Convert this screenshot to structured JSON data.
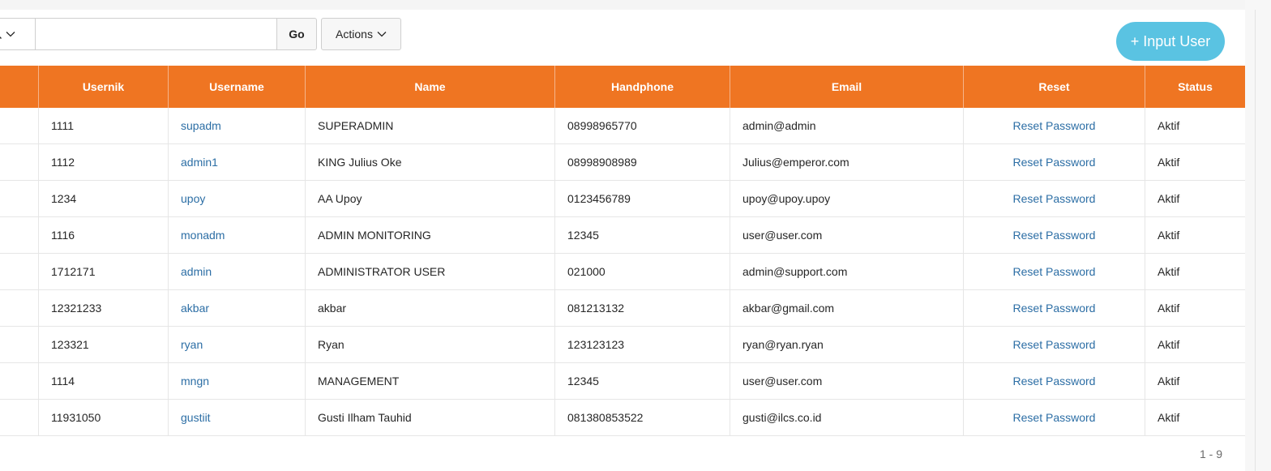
{
  "toolbar": {
    "search_icon": "search-icon",
    "search_placeholder": "",
    "search_value": "",
    "go_label": "Go",
    "actions_label": "Actions",
    "input_user_label": "+ Input User"
  },
  "table": {
    "columns": [
      "",
      "Usernik",
      "Username",
      "Name",
      "Handphone",
      "Email",
      "Reset",
      "Status"
    ],
    "rows": [
      {
        "usernik": "1111",
        "username": "supadm",
        "name": "SUPERADMIN",
        "handphone": "08998965770",
        "email": "admin@admin",
        "reset": "Reset Password",
        "status": "Aktif"
      },
      {
        "usernik": "1112",
        "username": "admin1",
        "name": "KING Julius Oke",
        "handphone": "08998908989",
        "email": "Julius@emperor.com",
        "reset": "Reset Password",
        "status": "Aktif"
      },
      {
        "usernik": "1234",
        "username": "upoy",
        "name": "AA Upoy",
        "handphone": "0123456789",
        "email": "upoy@upoy.upoy",
        "reset": "Reset Password",
        "status": "Aktif"
      },
      {
        "usernik": "1116",
        "username": "monadm",
        "name": "ADMIN MONITORING",
        "handphone": "12345",
        "email": "user@user.com",
        "reset": "Reset Password",
        "status": "Aktif"
      },
      {
        "usernik": "1712171",
        "username": "admin",
        "name": "ADMINISTRATOR USER",
        "handphone": "021000",
        "email": "admin@support.com",
        "reset": "Reset Password",
        "status": "Aktif"
      },
      {
        "usernik": "12321233",
        "username": "akbar",
        "name": "akbar",
        "handphone": "081213132",
        "email": "akbar@gmail.com",
        "reset": "Reset Password",
        "status": "Aktif"
      },
      {
        "usernik": "123321",
        "username": "ryan",
        "name": "Ryan",
        "handphone": "123123123",
        "email": "ryan@ryan.ryan",
        "reset": "Reset Password",
        "status": "Aktif"
      },
      {
        "usernik": "1114",
        "username": "mngn",
        "name": "MANAGEMENT",
        "handphone": "12345",
        "email": "user@user.com",
        "reset": "Reset Password",
        "status": "Aktif"
      },
      {
        "usernik": "11931050",
        "username": "gustiit",
        "name": "Gusti Ilham Tauhid",
        "handphone": "081380853522",
        "email": "gusti@ilcs.co.id",
        "reset": "Reset Password",
        "status": "Aktif"
      }
    ]
  },
  "pagination": {
    "range": "1 - 9"
  },
  "colors": {
    "header_bg": "#ef7522",
    "link": "#2c6ea5",
    "accent_button": "#5ac3e2"
  }
}
